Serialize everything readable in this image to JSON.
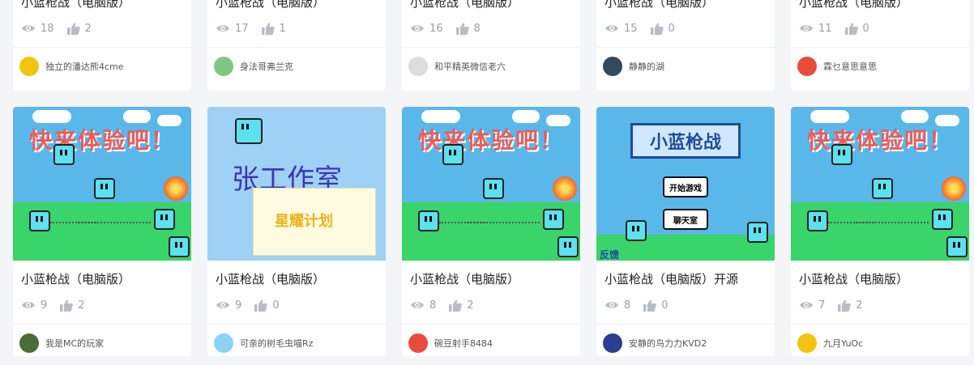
{
  "rows": [
    {
      "cards": [
        {
          "title": "小蓝枪战（电脑版）",
          "views": "18",
          "likes": "2",
          "author": "独立的潘达熊4cme",
          "avatar_color": "#f1c40f"
        },
        {
          "title": "小蓝枪战（电脑版）",
          "views": "17",
          "likes": "1",
          "author": "身法哥弗兰克",
          "avatar_color": "#7fc97f"
        },
        {
          "title": "小蓝枪战（电脑版）",
          "views": "16",
          "likes": "8",
          "author": "和平精英微信老六",
          "avatar_color": "#dddddd"
        },
        {
          "title": "小蓝枪战（电脑版）",
          "views": "15",
          "likes": "0",
          "author": "静静的湖",
          "avatar_color": "#34495e"
        },
        {
          "title": "小蓝枪战（电脑版）",
          "views": "11",
          "likes": "0",
          "author": "霖乜意思意思",
          "avatar_color": "#e74c3c"
        }
      ]
    },
    {
      "cards": [
        {
          "title": "小蓝枪战（电脑版）",
          "views": "9",
          "likes": "2",
          "author": "我是MC的玩家",
          "avatar_color": "#4b6b3a",
          "thumb": "game",
          "banner": "快来体验吧！"
        },
        {
          "title": "小蓝枪战（电脑版）",
          "views": "9",
          "likes": "0",
          "author": "可亲的树毛虫喵Rz",
          "avatar_color": "#8ad3f5",
          "thumb": "studio",
          "studio_text": "张工作室",
          "poster_text": "星耀计划"
        },
        {
          "title": "小蓝枪战（电脑版）",
          "views": "8",
          "likes": "2",
          "author": "碗豆射手8484",
          "avatar_color": "#e74c3c",
          "thumb": "game",
          "banner": "快来体验吧！"
        },
        {
          "title": "小蓝枪战（电脑版）开源",
          "views": "8",
          "likes": "0",
          "author": "安静的鸟力力KVD2",
          "avatar_color": "#2c3e8f",
          "thumb": "menu",
          "menu_title": "小蓝枪战",
          "menu_start": "开始游戏",
          "menu_chat": "聊天室",
          "menu_left": "反馈"
        },
        {
          "title": "小蓝枪战（电脑版）",
          "views": "7",
          "likes": "2",
          "author": "九月YuOc",
          "avatar_color": "#f1c40f",
          "thumb": "game",
          "banner": "快来体验吧！"
        }
      ]
    }
  ]
}
